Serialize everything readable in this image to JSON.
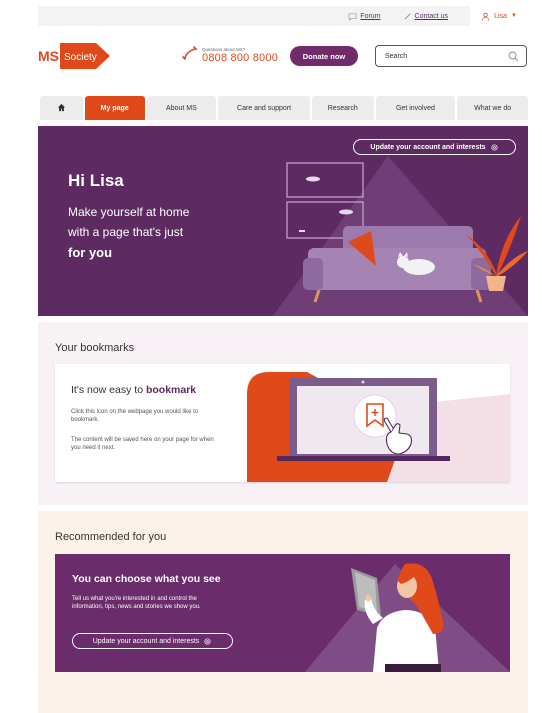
{
  "utility": {
    "forum": "Forum",
    "contact": "Contact us",
    "user": "Lisa"
  },
  "header": {
    "logo_ms": "MS",
    "logo_society": "Society",
    "phone_question": "Questions about MS?",
    "phone_number": "0808 800 8000",
    "donate": "Donate now",
    "search_placeholder": "Search"
  },
  "nav": {
    "items": [
      {
        "label": "My page",
        "active": true
      },
      {
        "label": "About MS"
      },
      {
        "label": "Care and support"
      },
      {
        "label": "Research"
      },
      {
        "label": "Get involved"
      },
      {
        "label": "What we do"
      }
    ]
  },
  "hero": {
    "update_button": "Update your account and interests",
    "greeting": "Hi Lisa",
    "line1": "Make yourself at home",
    "line2": "with a page that's just",
    "line3": "for you"
  },
  "bookmarks": {
    "title": "Your bookmarks",
    "heading_prefix": "It's now easy to",
    "heading_strong": "bookmark",
    "text1": "Click this icon on the webpage you would like to bookmark.",
    "text2": "The content will be saved here on your page for when you need it next."
  },
  "recommended": {
    "title": "Recommended for you",
    "heading": "You can choose what you see",
    "text": "Tell us what you're interested in and control the information, tips, news and stories we show you.",
    "button": "Update your account and interests"
  },
  "colors": {
    "brand_orange": "#e04a1a",
    "brand_purple": "#5d2a62",
    "donate_purple": "#6f2c68"
  }
}
